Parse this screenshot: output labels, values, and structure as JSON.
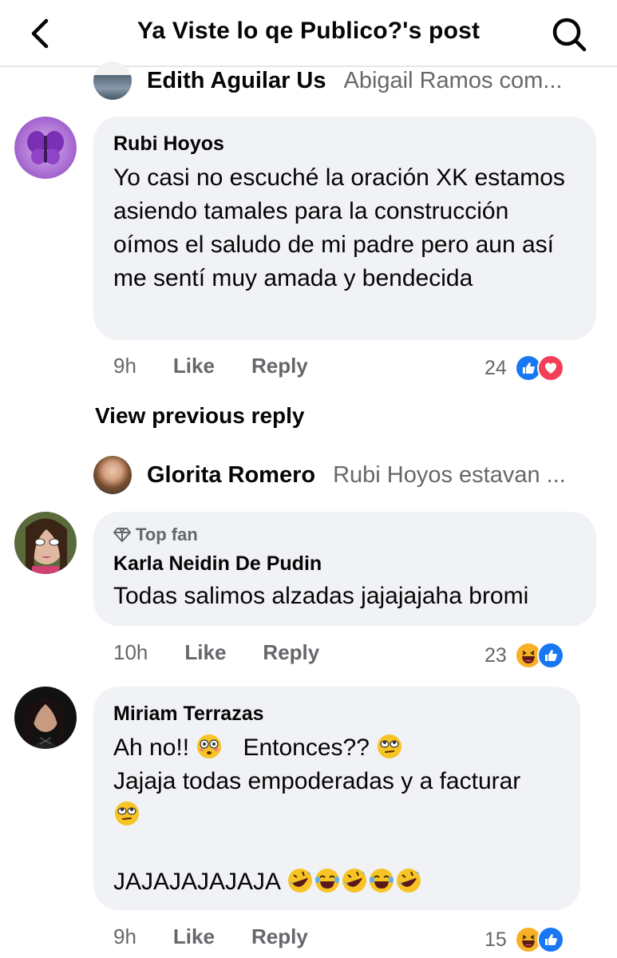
{
  "header": {
    "title": "Ya Viste lo qe Publico?'s post"
  },
  "reply_top": {
    "name": "Edith Aguilar Us",
    "text": "Abigail Ramos com..."
  },
  "comment1": {
    "name": "Rubi Hoyos",
    "text": "Yo casi no escuché la oración XK estamos asiendo tamales para la construcción oímos el saludo de mi padre pero aun así me sentí muy amada y bendecida",
    "time": "9h",
    "like": "Like",
    "reply": "Reply",
    "reactions": "24"
  },
  "view_previous": "View previous reply",
  "reply_mid": {
    "name": "Glorita Romero",
    "text": "Rubi Hoyos estavan ..."
  },
  "comment2": {
    "badge": "Top fan",
    "name": "Karla Neidin De Pudin",
    "text": "Todas salimos alzadas jajajajaha bromi",
    "time": "10h",
    "like": "Like",
    "reply": "Reply",
    "reactions": "23"
  },
  "comment3": {
    "name": "Miriam Terrazas",
    "line1a": "Ah no!!",
    "line1b": "Entonces??",
    "line2": "Jajaja todas empoderadas y a facturar",
    "line4": "JAJAJAJAJAJA",
    "time": "9h",
    "like": "Like",
    "reply": "Reply",
    "reactions": "15"
  },
  "icons": {
    "back": "chevron-left-icon",
    "search": "search-icon",
    "like_reaction": "like-reaction-icon",
    "love_reaction": "love-reaction-icon",
    "haha_reaction": "haha-reaction-icon",
    "top_fan": "diamond-icon"
  },
  "colors": {
    "bubble": "#f0f2f5",
    "like_blue": "#1877f2",
    "love_red": "#f33e58",
    "haha_yellow": "#f7b125",
    "secondary_text": "#65676b"
  }
}
